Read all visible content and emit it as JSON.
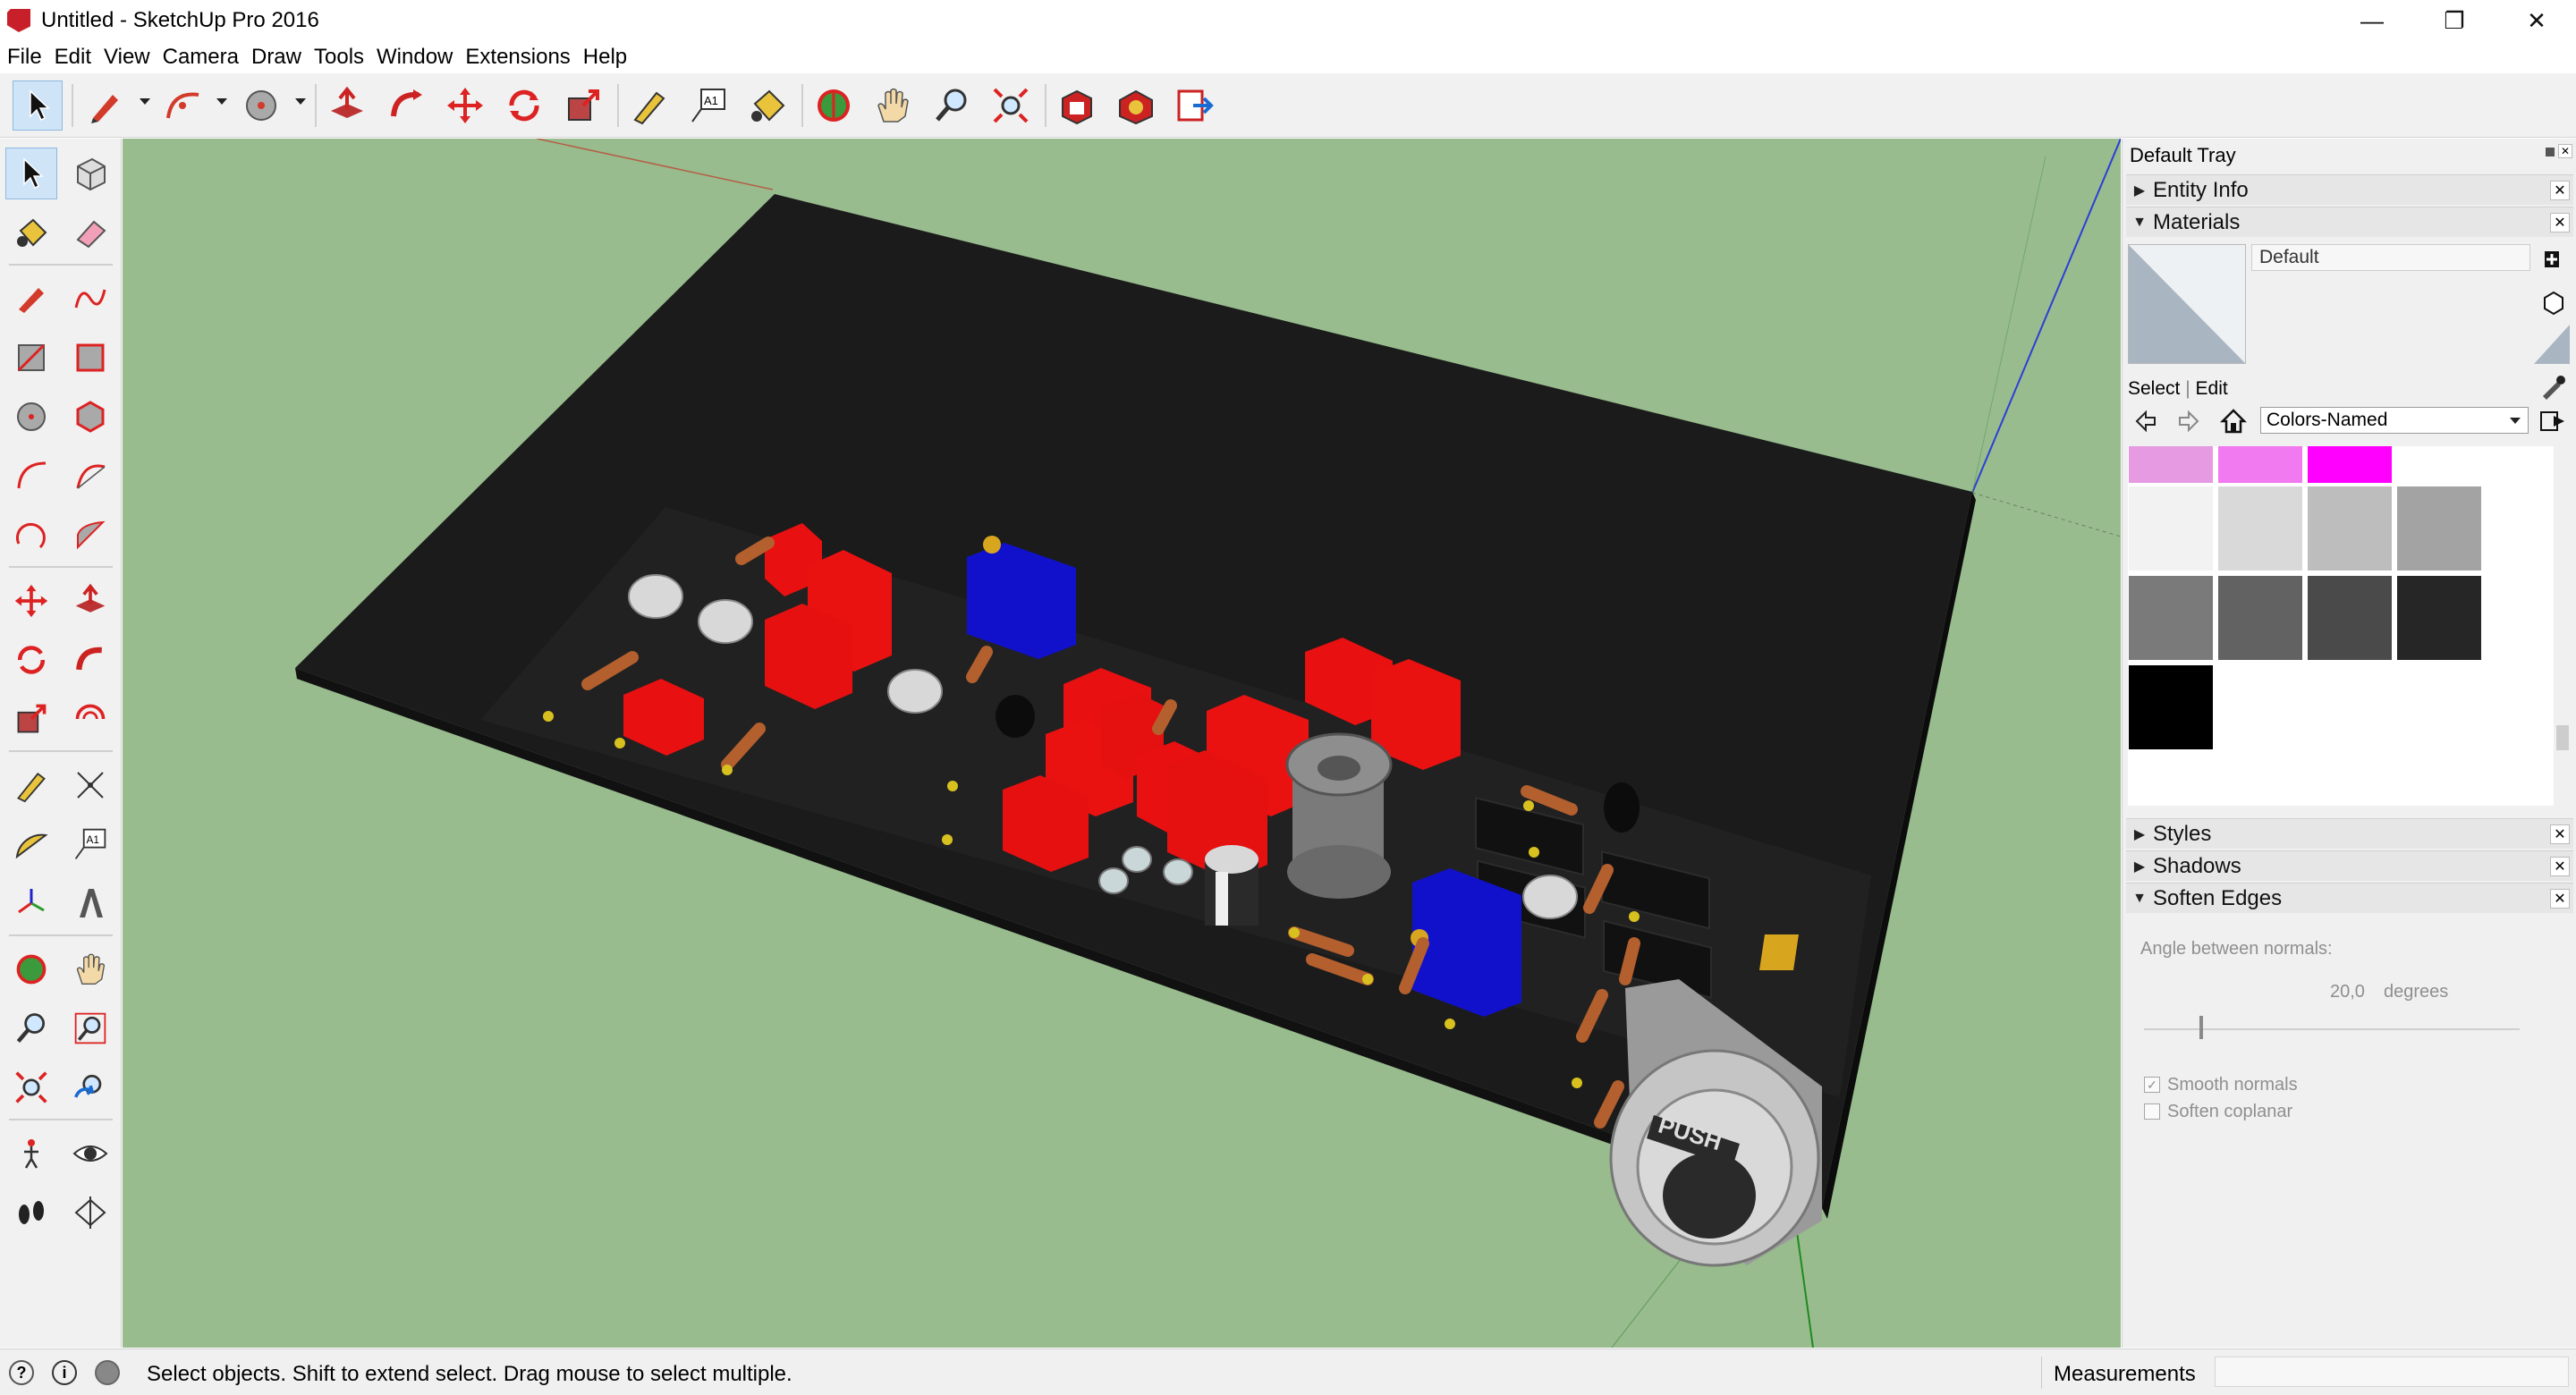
{
  "window": {
    "title": "Untitled - SketchUp Pro 2016",
    "minimize_glyph": "—",
    "restore_glyph": "❐",
    "close_glyph": "✕"
  },
  "menu": [
    "File",
    "Edit",
    "View",
    "Camera",
    "Draw",
    "Tools",
    "Window",
    "Extensions",
    "Help"
  ],
  "toolbar": {
    "tools": [
      "select-tool",
      "pencil-tool",
      "arc-tool",
      "circle-tool",
      "push-pull-tool",
      "follow-me-tool",
      "move-tool",
      "rotate-tool",
      "scale-tool",
      "tape-measure-tool",
      "text-tool",
      "paint-bucket-tool",
      "orbit-tool",
      "pan-tool",
      "zoom-tool",
      "zoom-extents-tool",
      "3d-warehouse",
      "extension-warehouse",
      "send-to-layout"
    ],
    "text_tool_glyph": "A1"
  },
  "left_palette": {
    "tools": [
      "select-tool",
      "component-tool",
      "paint-bucket-tool",
      "eraser-tool",
      "line-tool",
      "freehand-tool",
      "rectangle-tool",
      "rotated-rectangle-tool",
      "circle-tool",
      "polygon-tool",
      "arc-tool",
      "two-point-arc-tool",
      "three-point-arc-tool",
      "pie-tool",
      "move-tool",
      "push-pull-tool",
      "rotate-tool",
      "follow-me-tool",
      "scale-tool",
      "offset-tool",
      "tape-measure-tool",
      "dimension-tool",
      "protractor-tool",
      "text-tool",
      "axes-tool",
      "3d-text-tool",
      "orbit-tool",
      "pan-tool",
      "zoom-tool",
      "zoom-window-tool",
      "zoom-extents-tool",
      "previous-view-tool",
      "position-camera-tool",
      "look-around-tool",
      "walk-tool",
      "section-plane-tool"
    ],
    "text_tool_glyph": "A1"
  },
  "tray": {
    "title": "Default Tray",
    "panels": {
      "entity_info": "Entity Info",
      "materials": "Materials",
      "styles": "Styles",
      "shadows": "Shadows",
      "soften_edges": "Soften Edges"
    },
    "materials": {
      "current_name": "Default",
      "tab_select": "Select",
      "tab_edit": "Edit",
      "collection": "Colors-Named",
      "swatches": [
        "#e59ae2",
        "#f27af0",
        "#ff00ff",
        "#ffffff",
        "#f2f2f2",
        "#d9d9d9",
        "#bdbdbd",
        "#a3a3a3",
        "#7a7a7a",
        "#626262",
        "#4a4a4a",
        "#262626",
        "#000000"
      ]
    },
    "soften_edges": {
      "angle_label": "Angle between normals:",
      "angle_value": "20,0",
      "angle_unit": "degrees",
      "smooth_normals": "Smooth normals",
      "smooth_normals_checked": true,
      "soften_coplanar": "Soften coplanar",
      "soften_coplanar_checked": false
    }
  },
  "status": {
    "message": "Select objects. Shift to extend select. Drag mouse to select multiple.",
    "measurements_label": "Measurements",
    "measurements_value": ""
  },
  "scene": {
    "background": "#98bc8e",
    "board_color": "#1e1e1e",
    "component_red": "#ee1111",
    "component_blue": "#1010cc",
    "push_button_text": "PUSH"
  }
}
